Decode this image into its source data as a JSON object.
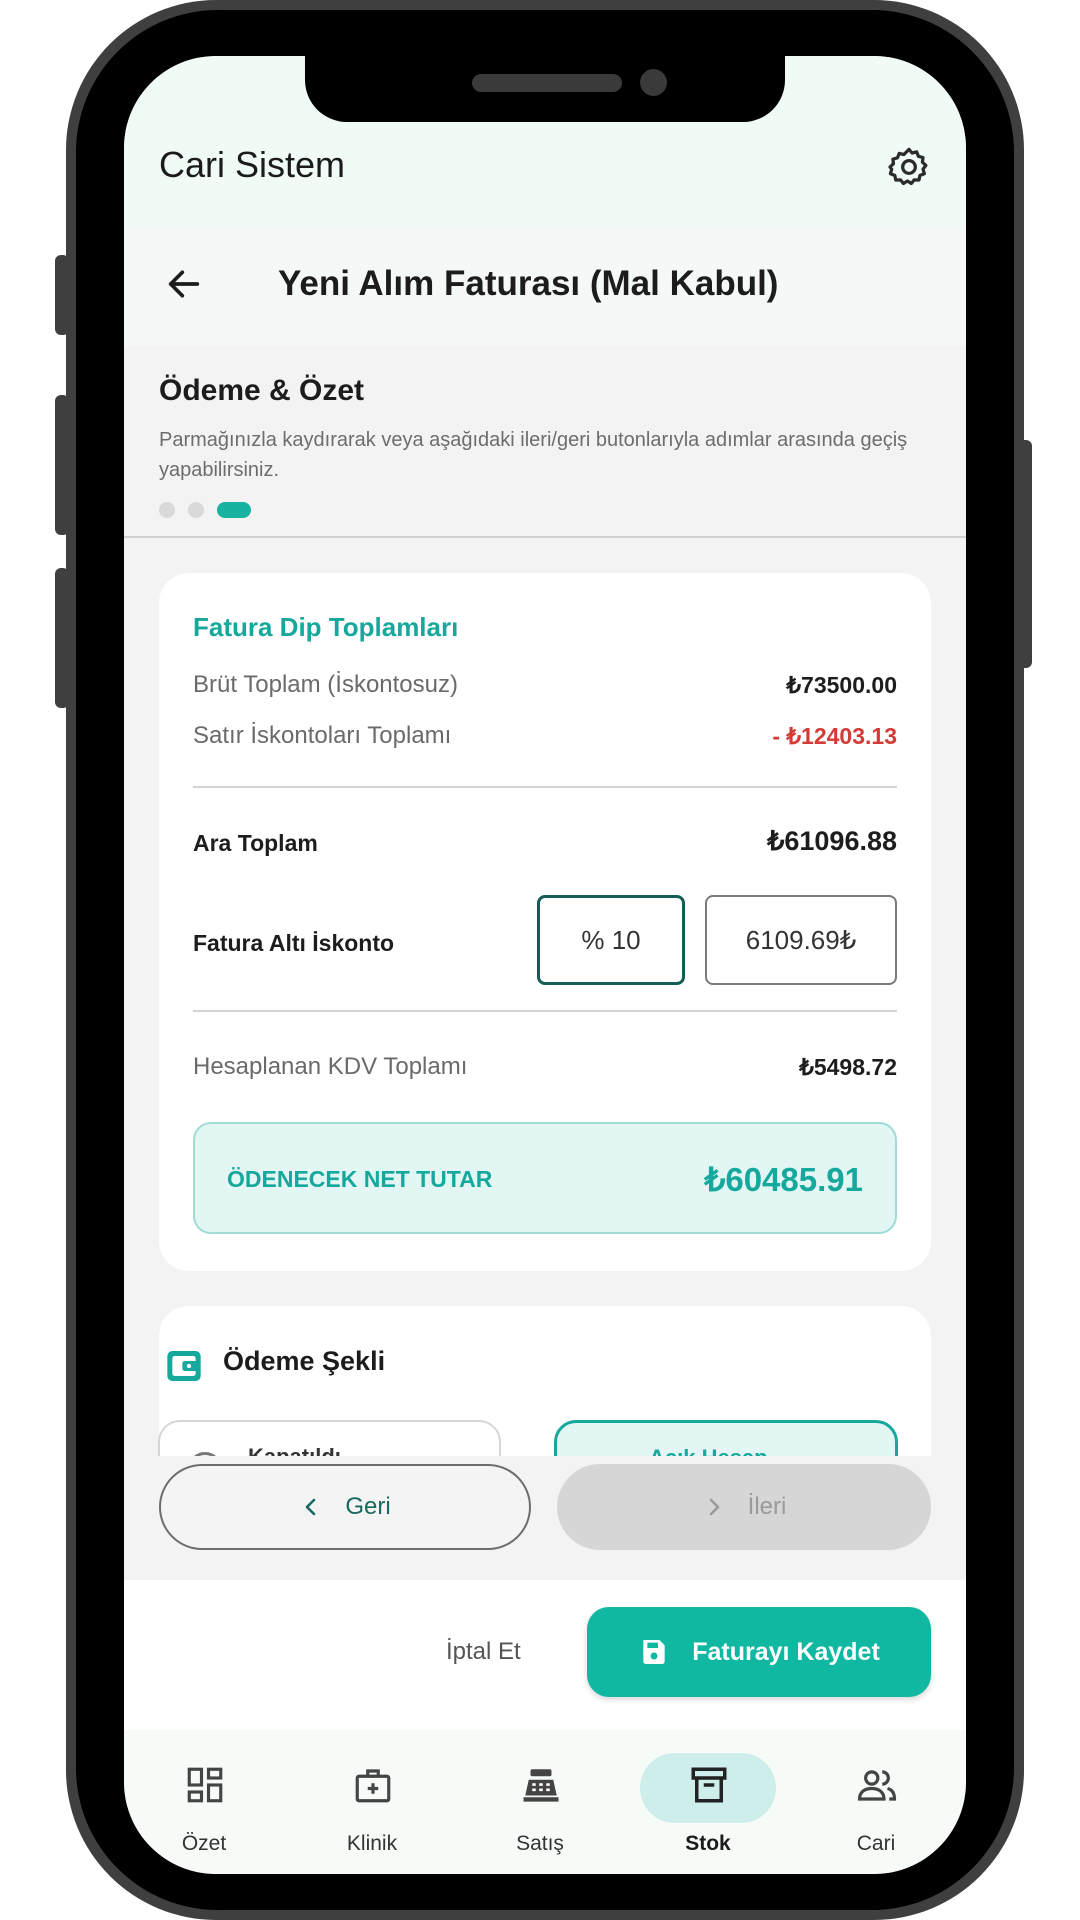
{
  "app": {
    "title": "Cari Sistem"
  },
  "header": {
    "title": "Yeni Alım Faturası (Mal Kabul)"
  },
  "step": {
    "title": "Ödeme & Özet",
    "description": "Parmağınızla kaydırarak veya aşağıdaki ileri/geri butonlarıyla adımlar arasında geçiş yapabilirsiniz.",
    "current": 3,
    "total": 3
  },
  "totals": {
    "title": "Fatura Dip Toplamları",
    "gross_label": "Brüt Toplam (İskontosuz)",
    "gross_value": "₺73500.00",
    "line_discount_label": "Satır İskontoları Toplamı",
    "line_discount_value": "- ₺12403.13",
    "subtotal_label": "Ara Toplam",
    "subtotal_value": "₺61096.88",
    "invoice_discount_label": "Fatura Altı İskonto",
    "discount_percent": "% 10",
    "discount_amount": "6109.69₺",
    "vat_label": "Hesaplanan KDV Toplamı",
    "vat_value": "₺5498.72",
    "net_label": "ÖDENECEK NET TUTAR",
    "net_value": "₺60485.91"
  },
  "payment": {
    "title": "Ödeme Şekli",
    "options": [
      "Kapatıldı",
      "Açık Hesap"
    ],
    "selected": "Açık Hesap"
  },
  "wizard": {
    "back_label": "Geri",
    "next_label": "İleri"
  },
  "footer": {
    "cancel_label": "İptal Et",
    "save_label": "Faturayı Kaydet"
  },
  "bottom_nav": {
    "items": [
      "Özet",
      "Klinik",
      "Satış",
      "Stok",
      "Cari"
    ],
    "active": "Stok"
  },
  "colors": {
    "accent": "#10b8a2",
    "accent_text": "#16a89c",
    "danger": "#d33c36"
  }
}
